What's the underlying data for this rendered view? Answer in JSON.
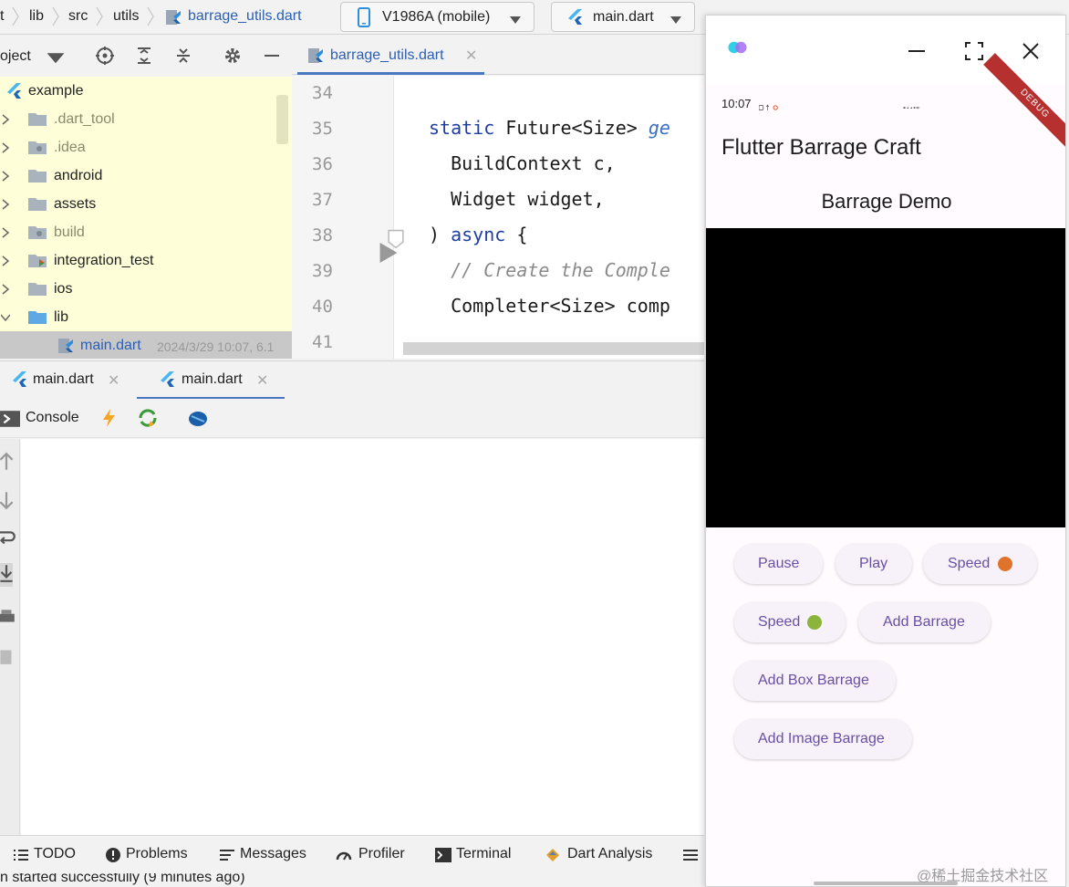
{
  "breadcrumbs": [
    "t",
    "lib",
    "src",
    "utils",
    "barrage_utils.dart"
  ],
  "device_selector": {
    "label": "V1986A (mobile)"
  },
  "run_config": {
    "label": "main.dart"
  },
  "project_panel": {
    "title": "oject",
    "tree": [
      {
        "label": "example",
        "type": "flutter"
      },
      {
        "label": ".dart_tool",
        "type": "folder",
        "muted": true
      },
      {
        "label": ".idea",
        "type": "folder",
        "muted": true
      },
      {
        "label": "android",
        "type": "folder"
      },
      {
        "label": "assets",
        "type": "folder"
      },
      {
        "label": "build",
        "type": "folder",
        "muted": true
      },
      {
        "label": "integration_test",
        "type": "folder"
      },
      {
        "label": "ios",
        "type": "folder"
      },
      {
        "label": "lib",
        "type": "folder",
        "expanded": true
      },
      {
        "label": "main.dart",
        "type": "file",
        "meta": "2024/3/29 10:07, 6.1"
      }
    ]
  },
  "editor": {
    "tab_label": "barrage_utils.dart",
    "line_numbers": [
      "34",
      "35",
      "36",
      "37",
      "38",
      "39",
      "40",
      "41"
    ],
    "code": {
      "l35_kw": "static",
      "l35_rest": " Future<Size> ",
      "l35_fn": "ge",
      "l36": "  BuildContext c,",
      "l37": "  Widget widget,",
      "l38_a": ") ",
      "l38_kw": "async",
      "l38_b": " {",
      "l39": "  // Create the Comple",
      "l40": "  Completer<Size> comp"
    }
  },
  "run_panel": {
    "tabs": [
      "main.dart",
      "main.dart"
    ],
    "console_label": "Console"
  },
  "bottom_bar": {
    "items": [
      "TODO",
      "Problems",
      "Messages",
      "Profiler",
      "Terminal",
      "Dart Analysis"
    ],
    "status": "n started successfully (9 minutes ago)"
  },
  "phone": {
    "status_time": "10:07",
    "debug_banner": "DEBUG",
    "app_title": "Flutter Barrage Craft",
    "demo_title": "Barrage Demo",
    "buttons": {
      "pause": "Pause",
      "play": "Play",
      "speed_up": "Speed",
      "speed_down": "Speed",
      "add_barrage": "Add Barrage",
      "add_box_barrage": "Add Box Barrage",
      "add_image_barrage": "Add Image Barrage"
    }
  },
  "watermark": "@稀土掘金技术社区",
  "colors": {
    "accent": "#6750a4",
    "selection": "#c8c8c8",
    "project_bg": "#fefed9",
    "tab_underline": "#4a78c0"
  }
}
